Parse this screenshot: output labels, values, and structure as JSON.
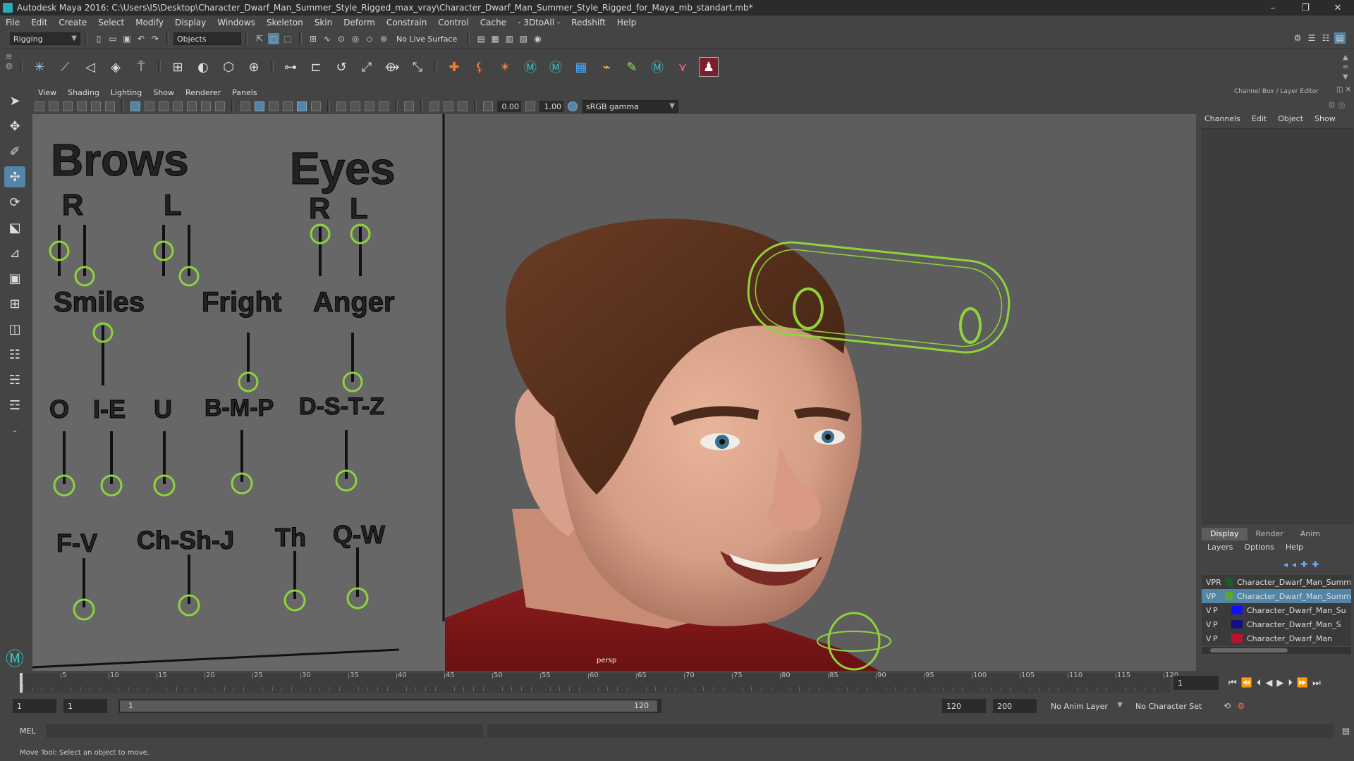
{
  "window": {
    "title": "Autodesk Maya 2016: C:\\Users\\I5\\Desktop\\Character_Dwarf_Man_Summer_Style_Rigged_max_vray\\Character_Dwarf_Man_Summer_Style_Rigged_for_Maya_mb_standart.mb*",
    "minimize": "–",
    "maximize": "❐",
    "close": "✕"
  },
  "menubar": [
    "File",
    "Edit",
    "Create",
    "Select",
    "Modify",
    "Display",
    "Windows",
    "Skeleton",
    "Skin",
    "Deform",
    "Constrain",
    "Control",
    "Cache",
    "- 3DtoAll -",
    "Redshift",
    "Help"
  ],
  "statusline": {
    "menuset": "Rigging",
    "objects": "Objects",
    "live_surface": "No Live Surface"
  },
  "viewport": {
    "menu": [
      "View",
      "Shading",
      "Lighting",
      "Show",
      "Renderer",
      "Panels"
    ],
    "exposure": "0.00",
    "gamma": "1.00",
    "colorspace": "sRGB gamma",
    "camera_label": "persp"
  },
  "facepanel": {
    "brows_title": "Brows",
    "eyes_title": "Eyes",
    "brows_r": "R",
    "brows_l": "L",
    "eyes_r": "R",
    "eyes_l": "L",
    "smiles": "Smiles",
    "fright": "Fright",
    "anger": "Anger",
    "o": "O",
    "i_e": "I-E",
    "u": "U",
    "b_m_p": "B-M-P",
    "d_s_t_z": "D-S-T-Z",
    "f_v": "F-V",
    "ch_sh_j": "Ch-Sh-J",
    "th": "Th",
    "q_w": "Q-W"
  },
  "channelbox": {
    "title": "Channel Box / Layer Editor",
    "menu": [
      "Channels",
      "Edit",
      "Object",
      "Show"
    ],
    "layer_tabs": [
      "Display",
      "Render",
      "Anim"
    ],
    "layer_menu": [
      "Layers",
      "Options",
      "Help"
    ],
    "layers": [
      {
        "v": "V",
        "p": "P",
        "r": "R",
        "color": "#1f5a2a",
        "name": "Character_Dwarf_Man_Summ",
        "selected": false
      },
      {
        "v": "V",
        "p": "P",
        "r": "",
        "color": "#5aa832",
        "name": "Character_Dwarf_Man_Summ",
        "selected": true
      },
      {
        "v": "V",
        "p": "P",
        "r": "",
        "color": "#1010ff",
        "name": "Character_Dwarf_Man_Su",
        "selected": false
      },
      {
        "v": "V",
        "p": "P",
        "r": "",
        "color": "#101080",
        "name": "Character_Dwarf_Man_S",
        "selected": false
      },
      {
        "v": "V",
        "p": "P",
        "r": "",
        "color": "#c01030",
        "name": "Character_Dwarf_Man",
        "selected": false
      }
    ]
  },
  "timeline": {
    "ticks": [
      "5",
      "10",
      "15",
      "20",
      "25",
      "30",
      "35",
      "40",
      "45",
      "50",
      "55",
      "60",
      "65",
      "70",
      "75",
      "80",
      "85",
      "90",
      "95",
      "100",
      "105",
      "110",
      "115",
      "120"
    ],
    "start_tick": "1",
    "current_frame": "1"
  },
  "range": {
    "start": "1",
    "playback_start": "1",
    "slider_start": "1",
    "slider_end": "120",
    "playback_end": "120",
    "end": "200",
    "anim_layer": "No Anim Layer",
    "char_set": "No Character Set"
  },
  "mel": {
    "label": "MEL"
  },
  "helpline": "Move Tool: Select an object to move."
}
